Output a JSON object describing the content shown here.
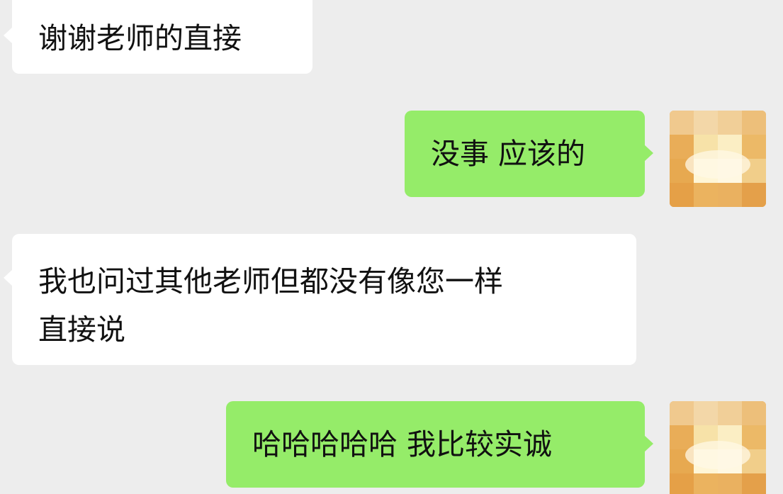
{
  "messages": [
    {
      "sender": "other",
      "text": "谢谢老师的直接"
    },
    {
      "sender": "me",
      "text": "没事 应该的"
    },
    {
      "sender": "other",
      "text": "我也问过其他老师但都没有像您一样",
      "text2": "直接说"
    },
    {
      "sender": "me",
      "text": "哈哈哈哈哈 我比较实诚"
    }
  ],
  "colors": {
    "background": "#ededed",
    "incoming_bubble": "#ffffff",
    "outgoing_bubble": "#95ec69",
    "avatar_primary": "#e8a64a",
    "avatar_highlight": "#fff3c2"
  }
}
